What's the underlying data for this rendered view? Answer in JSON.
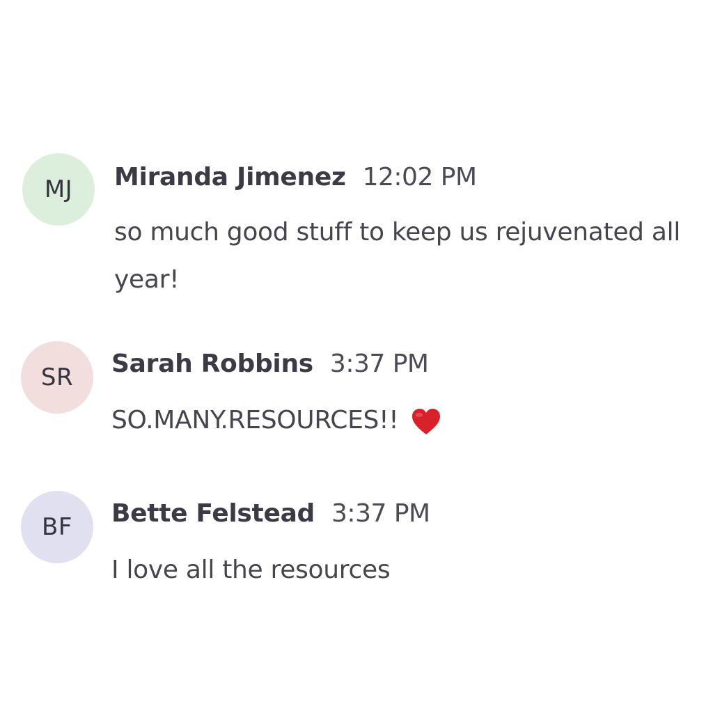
{
  "messages": [
    {
      "initials": "MJ",
      "avatar_color": "#dcefdc",
      "author": "Miranda Jimenez",
      "time": "12:02 PM",
      "text": "so much good stuff to keep us rejuvenated all year!"
    },
    {
      "initials": "SR",
      "avatar_color": "#f3dede",
      "author": "Sarah Robbins",
      "time": "3:37 PM",
      "text": "SO.MANY.RESOURCES!!",
      "emoji": "heart-icon"
    },
    {
      "initials": "BF",
      "avatar_color": "#e1e0f1",
      "author": "Bette Felstead",
      "time": "3:37 PM",
      "text": "I love all the resources"
    }
  ],
  "colors": {
    "heart": "#d8222b"
  }
}
